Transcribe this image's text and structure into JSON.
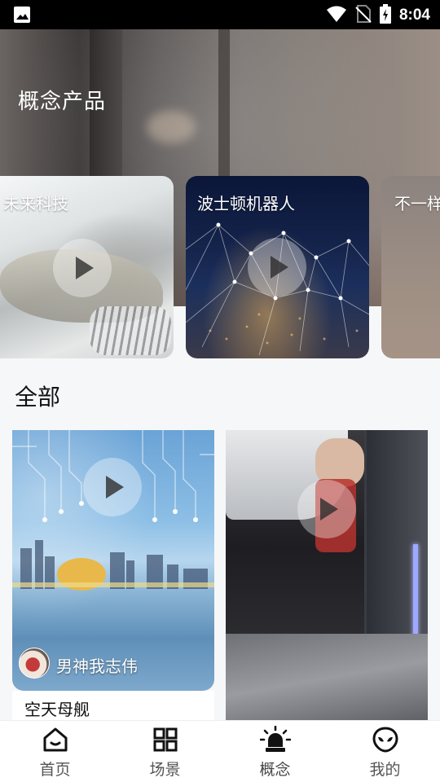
{
  "status_bar": {
    "time": "8:04",
    "icons": [
      "image-icon",
      "wifi-icon",
      "no-sim-icon",
      "battery-charging-icon"
    ]
  },
  "hero": {
    "title": "概念产品"
  },
  "carousel": [
    {
      "label": "未来科技"
    },
    {
      "label": "波士顿机器人"
    },
    {
      "label": "不一样"
    }
  ],
  "section": {
    "title": "全部"
  },
  "videos": [
    {
      "author": "男神我志伟",
      "title": "空天母舰"
    },
    {
      "author": "",
      "title": ""
    }
  ],
  "tabbar": {
    "items": [
      {
        "label": "首页",
        "icon": "home-icon"
      },
      {
        "label": "场景",
        "icon": "grid-icon"
      },
      {
        "label": "概念",
        "icon": "bulb-icon"
      },
      {
        "label": "我的",
        "icon": "alien-icon"
      }
    ],
    "active": "概念"
  },
  "colors": {
    "status_bar": "#000000",
    "tab_label": "#555555",
    "background": "#f6f7f9"
  }
}
